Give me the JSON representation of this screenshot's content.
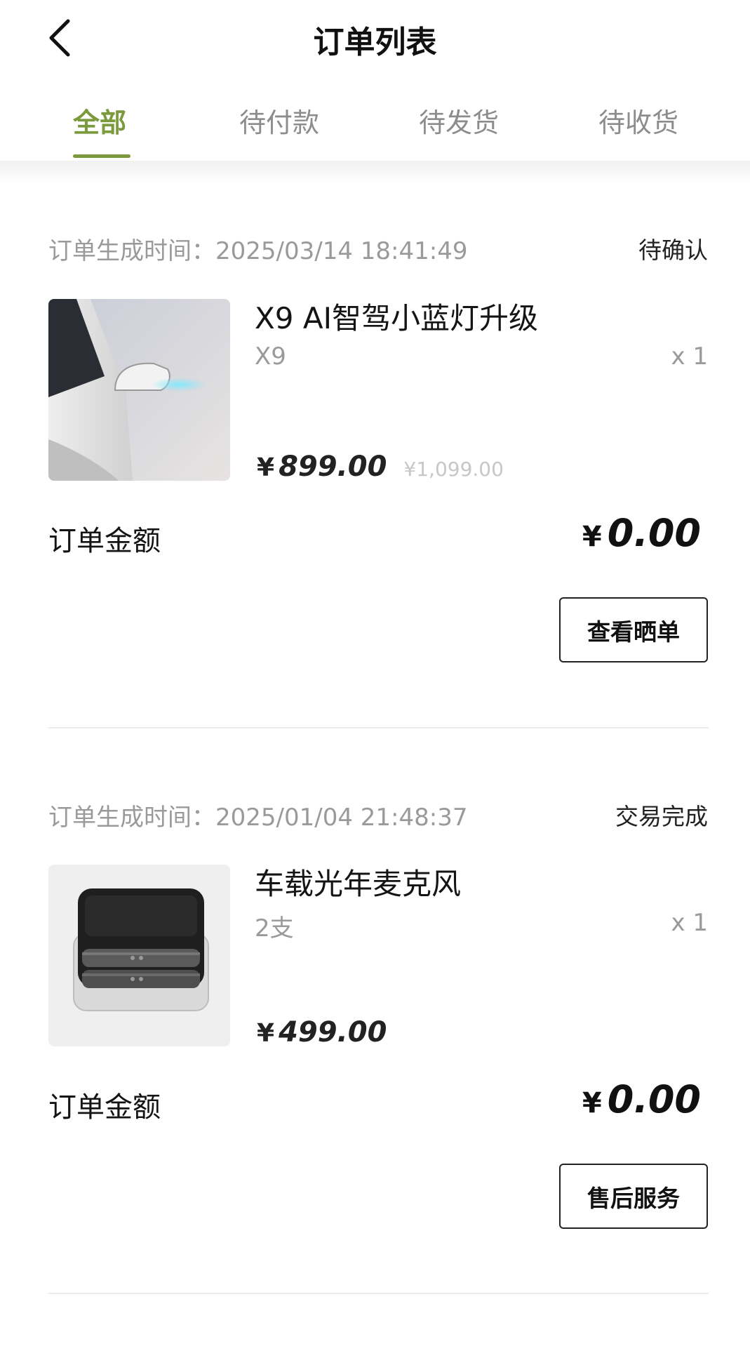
{
  "header": {
    "title": "订单列表"
  },
  "tabs": [
    {
      "label": "全部",
      "active": true
    },
    {
      "label": "待付款",
      "active": false
    },
    {
      "label": "待发货",
      "active": false
    },
    {
      "label": "待收货",
      "active": false
    }
  ],
  "colors": {
    "accent": "#7a9a3d",
    "text": "#141414",
    "muted": "#9a9a9a"
  },
  "orders": [
    {
      "time": "订单生成时间：2025/03/14 18:41:49",
      "status": "待确认",
      "product_name": "X9 AI智驾小蓝灯升级",
      "spec": "X9",
      "qty": "x 1",
      "price_symbol": "¥",
      "price": "899.00",
      "original_price": "¥1,099.00",
      "total_label": "订单金额",
      "total_symbol": "¥",
      "total": "0.00",
      "action": "查看晒单"
    },
    {
      "time": "订单生成时间：2025/01/04 21:48:37",
      "status": "交易完成",
      "product_name": "车载光年麦克风",
      "spec": "2支",
      "qty": "x 1",
      "price_symbol": "¥",
      "price": "499.00",
      "total_label": "订单金额",
      "total_symbol": "¥",
      "total": "0.00",
      "action": "售后服务"
    }
  ]
}
